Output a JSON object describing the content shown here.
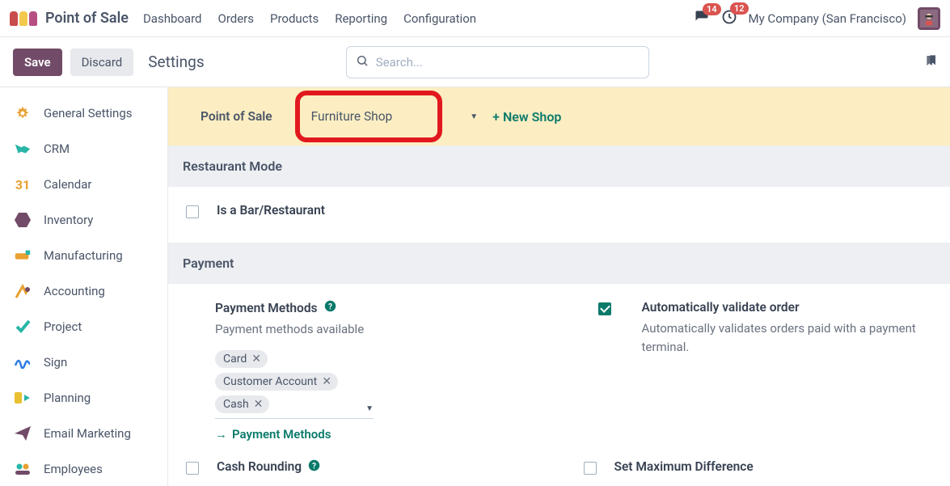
{
  "topbar": {
    "app_title": "Point of Sale",
    "nav": [
      "Dashboard",
      "Orders",
      "Products",
      "Reporting",
      "Configuration"
    ],
    "messages_badge": "14",
    "activities_badge": "12",
    "company": "My Company (San Francisco)"
  },
  "toolbar": {
    "save_label": "Save",
    "discard_label": "Discard",
    "title": "Settings",
    "search_placeholder": "Search..."
  },
  "sidebar": {
    "items": [
      "General Settings",
      "CRM",
      "Calendar",
      "Inventory",
      "Manufacturing",
      "Accounting",
      "Project",
      "Sign",
      "Planning",
      "Email Marketing",
      "Employees"
    ]
  },
  "tabs": {
    "pos_label": "Point of Sale",
    "shop_label": "Furniture Shop",
    "new_shop_label": "+ New Shop"
  },
  "sections": {
    "restaurant_mode": {
      "header": "Restaurant Mode",
      "is_bar_label": "Is a Bar/Restaurant"
    },
    "payment": {
      "header": "Payment",
      "methods_title": "Payment Methods",
      "methods_sub": "Payment methods available",
      "tags": [
        "Card",
        "Customer Account",
        "Cash"
      ],
      "methods_link": "Payment Methods",
      "auto_validate_title": "Automatically validate order",
      "auto_validate_sub": "Automatically validates orders paid with a payment terminal.",
      "cash_rounding_title": "Cash Rounding",
      "max_diff_title": "Set Maximum Difference"
    }
  }
}
